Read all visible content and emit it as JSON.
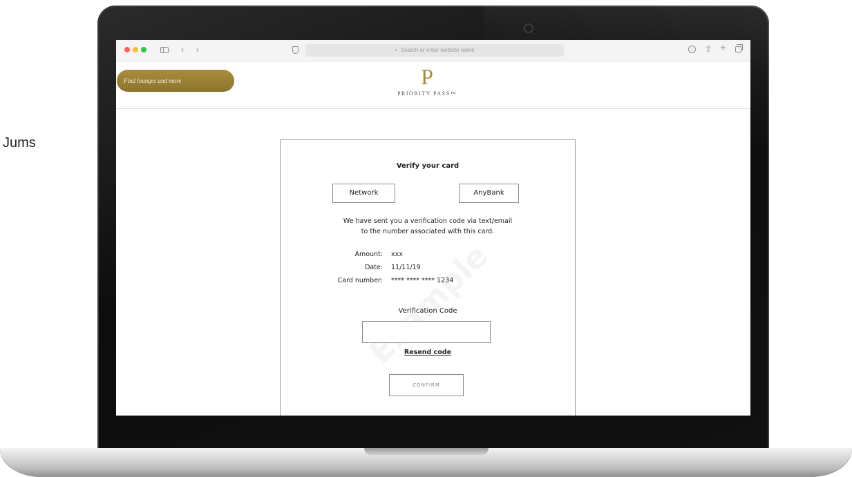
{
  "side_text": "Jums",
  "browser": {
    "search_placeholder": "Search or enter website name",
    "back_glyph": "‹",
    "forward_glyph": "›",
    "plus_glyph": "+",
    "share_glyph": "⇧",
    "download_glyph": "↓",
    "search_glyph": "⌕"
  },
  "site": {
    "find_button_label": "Find lounges and more",
    "logo_letter": "P",
    "logo_text": "PRIORITY PASS™"
  },
  "card_form": {
    "title": "Verify your card",
    "network_label": "Network",
    "bank_label": "AnyBank",
    "message_line1": "We have sent you a verification code via text/email",
    "message_line2": "to the number associated with this card.",
    "details": [
      {
        "label": "Amount:",
        "value": "xxx"
      },
      {
        "label": "Date:",
        "value": "11/11/19"
      },
      {
        "label": "Card number:",
        "value": "**** **** **** 1234"
      }
    ],
    "code_label": "Verification Code",
    "code_value": "",
    "resend_label": "Resend code",
    "confirm_label": "CONFIRM",
    "watermark": "Example"
  }
}
